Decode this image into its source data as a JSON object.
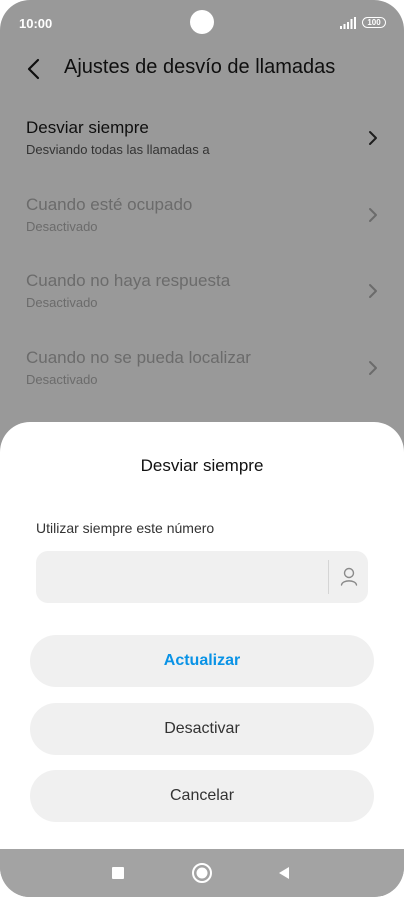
{
  "status_bar": {
    "time": "10:00",
    "battery": "100"
  },
  "header": {
    "title": "Ajustes de desvío de llamadas"
  },
  "settings": [
    {
      "title": "Desviar siempre",
      "subtitle": "Desviando todas las llamadas a",
      "enabled": true
    },
    {
      "title": "Cuando esté ocupado",
      "subtitle": "Desactivado",
      "enabled": false
    },
    {
      "title": "Cuando no haya respuesta",
      "subtitle": "Desactivado",
      "enabled": false
    },
    {
      "title": "Cuando no se pueda localizar",
      "subtitle": "Desactivado",
      "enabled": false
    }
  ],
  "dialog": {
    "title": "Desviar siempre",
    "field_label": "Utilizar siempre este número",
    "field_value": "",
    "field_placeholder": "",
    "buttons": {
      "update": "Actualizar",
      "disable": "Desactivar",
      "cancel": "Cancelar"
    }
  },
  "icons": {
    "back": "back-arrow-icon",
    "chevron": "chevron-right-icon",
    "contact": "contact-person-icon",
    "nav_recent": "square-icon",
    "nav_home": "circle-icon",
    "nav_back": "triangle-icon"
  },
  "colors": {
    "accent": "#0a93e6",
    "overlay": "rgba(0,0,0,0.4)",
    "sheet_button_bg": "#f0f0f0"
  }
}
